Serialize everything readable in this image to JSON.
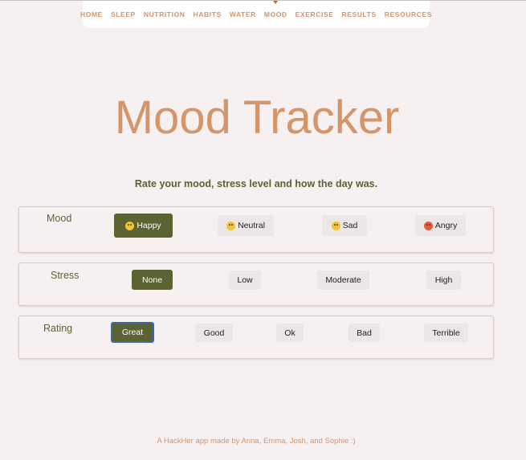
{
  "nav": {
    "items": [
      "HOME",
      "SLEEP",
      "NUTRITION",
      "HABITS",
      "WATER",
      "MOOD",
      "EXERCISE",
      "RESULTS",
      "RESOURCES"
    ],
    "active": "MOOD"
  },
  "page": {
    "title": "Mood Tracker",
    "subtitle": "Rate your mood, stress level and how the day was."
  },
  "mood": {
    "label": "Mood",
    "options": [
      {
        "label": "Happy",
        "icon": "smiling-face-icon"
      },
      {
        "label": "Neutral",
        "icon": "neutral-face-icon"
      },
      {
        "label": "Sad",
        "icon": "sad-face-icon"
      },
      {
        "label": "Angry",
        "icon": "angry-face-icon"
      }
    ],
    "selected": "Happy"
  },
  "stress": {
    "label": "Stress",
    "options": [
      "None",
      "Low",
      "Moderate",
      "High"
    ],
    "selected": "None"
  },
  "rating": {
    "label": "Rating",
    "options": [
      "Great",
      "Good",
      "Ok",
      "Bad",
      "Terrible"
    ],
    "selected": "Great"
  },
  "footer": {
    "text": "A HackHer app made by Anna, Emma, Josh, and Sophie :)"
  },
  "colors": {
    "accent": "#d4956a",
    "selected": "#5b6333",
    "label": "#5a6236",
    "background": "#f7f0f0"
  }
}
